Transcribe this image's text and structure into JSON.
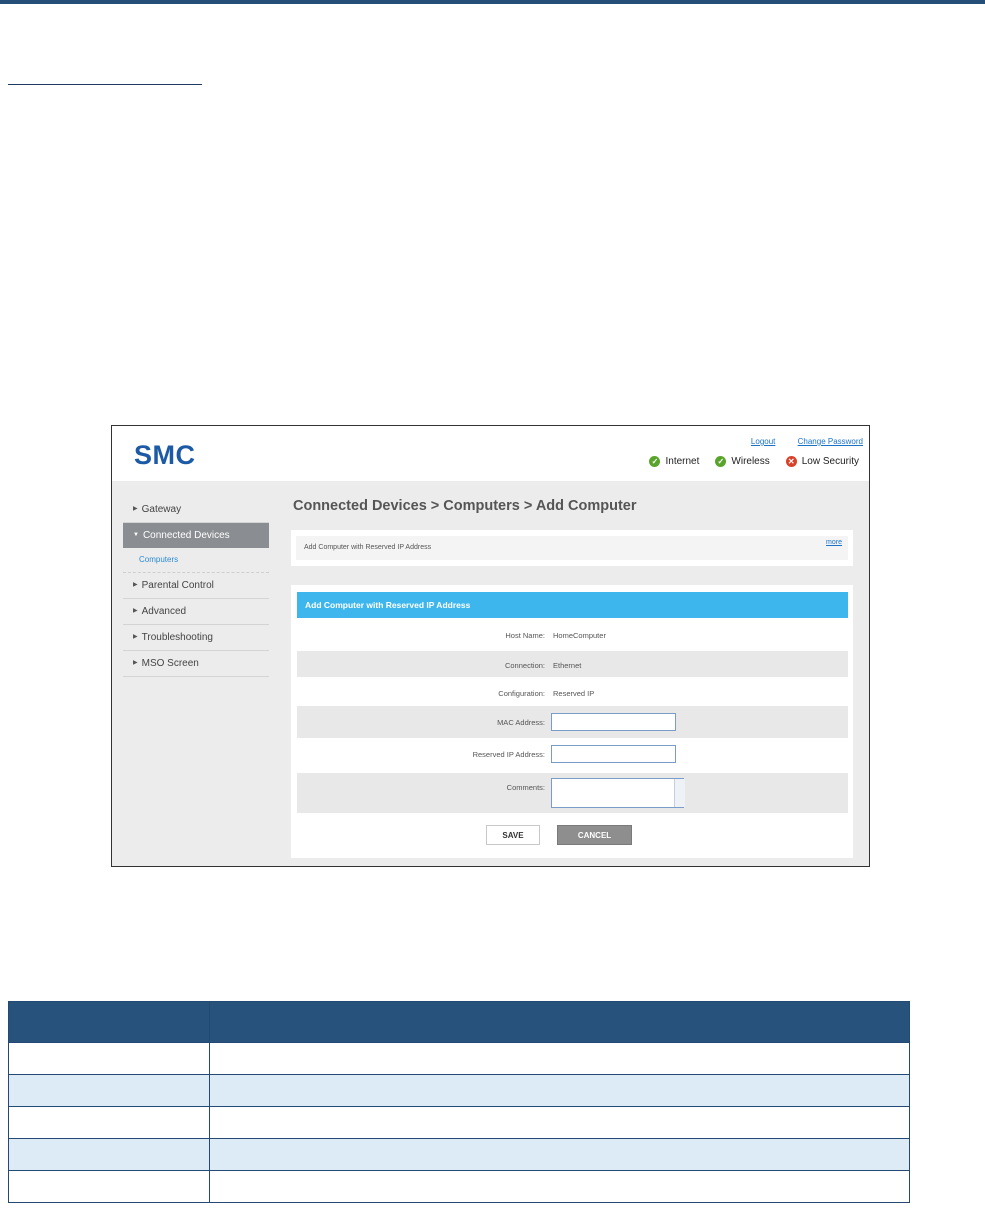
{
  "doc": {
    "table": {
      "headers": [
        "",
        ""
      ],
      "rows": [
        [
          "",
          ""
        ],
        [
          "",
          ""
        ],
        [
          "",
          ""
        ],
        [
          "",
          ""
        ],
        [
          "",
          ""
        ]
      ]
    }
  },
  "screenshot": {
    "logo": "SMC",
    "top_links": {
      "logout": "Logout",
      "change_password": "Change Password"
    },
    "status": [
      {
        "label": "Internet",
        "state": "ok",
        "icon": "check-circle-icon"
      },
      {
        "label": "Wireless",
        "state": "ok",
        "icon": "check-circle-icon"
      },
      {
        "label": "Low Security",
        "state": "bad",
        "icon": "x-circle-icon"
      }
    ],
    "colors": {
      "brand": "#1c5aa6",
      "accent": "#3db6ee",
      "ok": "#59a52c",
      "bad": "#d8422a",
      "table_header": "#27527b",
      "table_alt": "#ddebf7"
    },
    "sidebar": {
      "items": [
        {
          "label": "Gateway",
          "active": false
        },
        {
          "label": "Connected Devices",
          "active": true
        },
        {
          "label": "Computers",
          "sub": true
        },
        {
          "label": "Parental Control",
          "active": false
        },
        {
          "label": "Advanced",
          "active": false
        },
        {
          "label": "Troubleshooting",
          "active": false
        },
        {
          "label": "MSO Screen",
          "active": false
        }
      ]
    },
    "page_title": "Connected Devices > Computers > Add Computer",
    "info": {
      "text": "Add Computer with Reserved IP Address",
      "more": "more"
    },
    "form": {
      "title": "Add Computer with Reserved IP Address",
      "host_name_label": "Host Name:",
      "host_name_value": "HomeComputer",
      "connection_label": "Connection:",
      "connection_value": "Ethernet",
      "configuration_label": "Configuration:",
      "configuration_value": "Reserved IP",
      "mac_label": "MAC Address:",
      "mac_value": "",
      "reserved_ip_label": "Reserved IP Address:",
      "reserved_ip_value": "",
      "comments_label": "Comments:",
      "comments_value": "",
      "save": "SAVE",
      "cancel": "CANCEL"
    }
  }
}
